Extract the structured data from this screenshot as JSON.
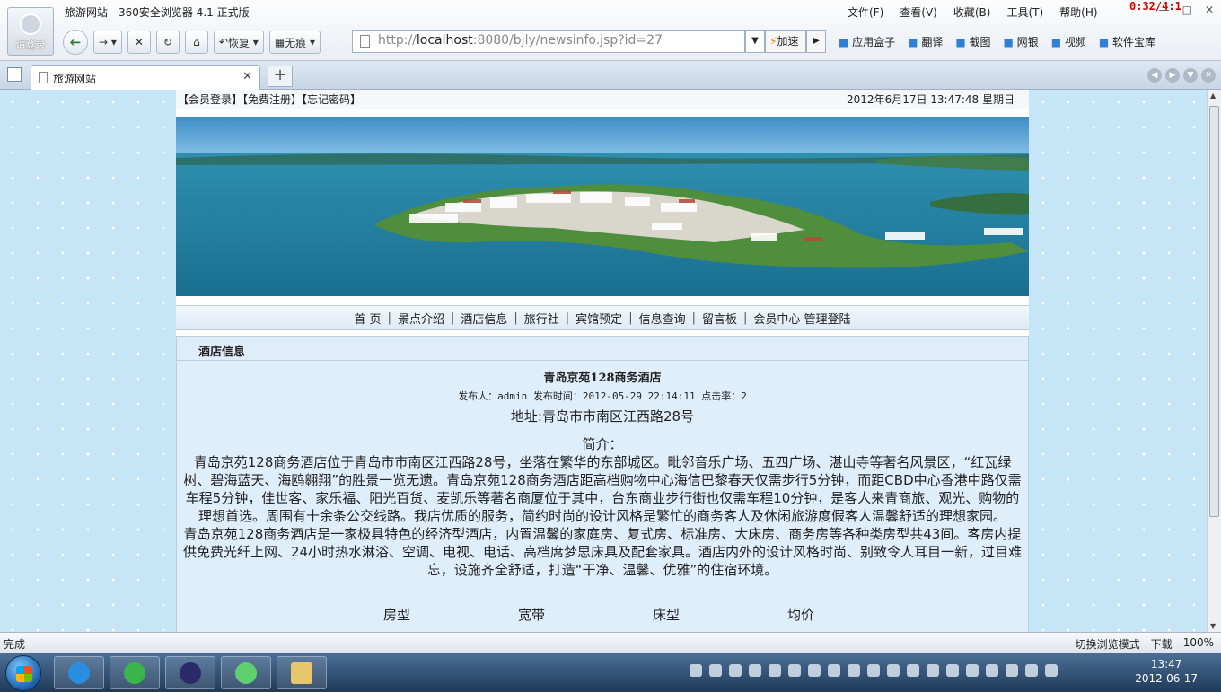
{
  "browser": {
    "window_title": "旅游网站 - 360安全浏览器 4.1 正式版",
    "login_label": "请登录",
    "menu": [
      "文件(F)",
      "查看(V)",
      "收藏(B)",
      "工具(T)",
      "帮助(H)"
    ],
    "overlay_timer": "0:32/4:1",
    "nav": {
      "restore": "恢复",
      "private": "无痕"
    },
    "url_prefix": "http://",
    "url_host": "localhost",
    "url_rest": ":8080/bjly/newsinfo.jsp?id=27",
    "accelerate": "加速",
    "plugins": [
      "应用盒子",
      "翻译",
      "截图",
      "网银",
      "视频",
      "软件宝库"
    ],
    "tab_title": "旅游网站",
    "status_text": "完成",
    "status_right": [
      "切换浏览模式",
      "下载",
      "100%"
    ]
  },
  "site": {
    "top_links": "【会员登录】【免费注册】【忘记密码】",
    "datetime": "2012年6月17日  13:47:48   星期日",
    "nav_items": [
      "首 页",
      "景点介绍",
      "酒店信息",
      "旅行社",
      "宾馆预定",
      "信息查询",
      "留言板",
      "会员中心"
    ],
    "nav_admin": "管理登陆",
    "section_title": "酒店信息",
    "article": {
      "title": "青岛京苑128商务酒店",
      "meta": "发布人：admin 发布时间：2012-05-29 22:14:11 点击率：2",
      "address": "地址:青岛市市南区江西路28号",
      "intro_heading": "简介：",
      "p1": "青岛京苑128商务酒店位于青岛市市南区江西路28号，坐落在繁华的东部城区。毗邻音乐广场、五四广场、湛山寺等著名风景区，“红瓦绿树、碧海蓝天、海鸥翱翔”的胜景一览无遗。青岛京苑128商务酒店距高档购物中心海信巴黎春天仅需步行5分钟，而距CBD中心香港中路仅需车程5分钟，佳世客、家乐福、阳光百货、麦凯乐等著名商厦位于其中，台东商业步行街也仅需车程10分钟，是客人来青商旅、观光、购物的理想首选。周围有十余条公交线路。我店优质的服务，简约时尚的设计风格是繁忙的商务客人及休闲旅游度假客人温馨舒适的理想家园。",
      "p2": "青岛京苑128商务酒店是一家极具特色的经济型酒店，内置温馨的家庭房、复式房、标准房、大床房、商务房等各种类房型共43间。客房内提供免费光纤上网、24小时热水淋浴、空调、电视、电话、高档席梦思床具及配套家具。酒店内外的设计风格时尚、别致令人耳目一新，过目难忘，设施齐全舒适，打造“干净、温馨、优雅”的住宿环境。",
      "room_headers": [
        "房型",
        "宽带",
        "床型",
        "均价"
      ]
    }
  },
  "taskbar": {
    "time": "13:47",
    "date": "2012-06-17"
  },
  "colors": {
    "page_bg": "#c6e6f8",
    "nav_bg": "#dfeaf5",
    "article_bg": "#dfeefb",
    "taskbar": "#203a58"
  }
}
